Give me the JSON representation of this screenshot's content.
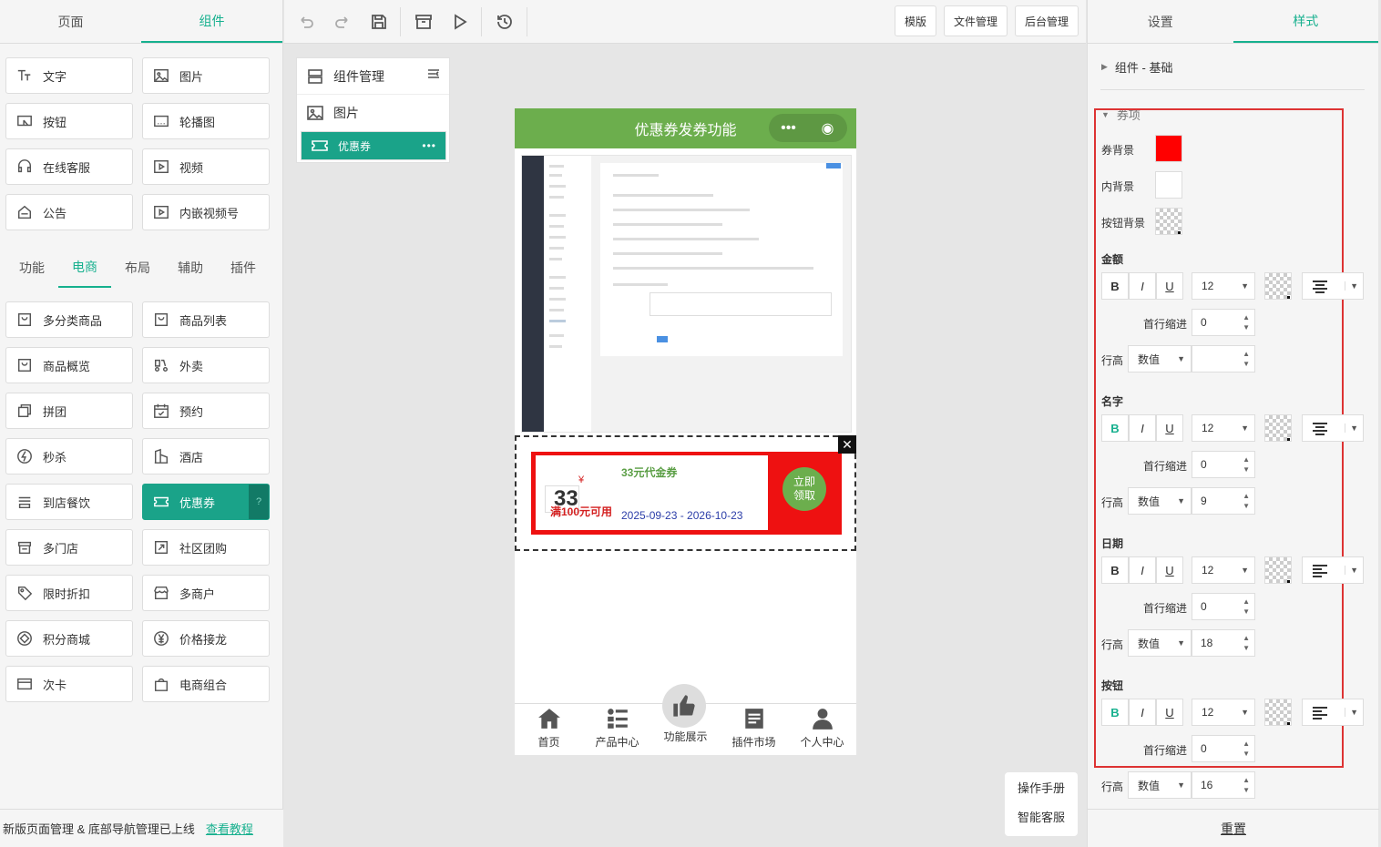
{
  "left_tabs": [
    "页面",
    "组件"
  ],
  "basic_components": [
    "文字",
    "图片",
    "按钮",
    "轮播图",
    "在线客服",
    "视频",
    "公告",
    "内嵌视频号"
  ],
  "category_tabs": [
    "功能",
    "电商",
    "布局",
    "辅助",
    "插件"
  ],
  "ecommerce_components": [
    "多分类商品",
    "商品列表",
    "商品概览",
    "外卖",
    "拼团",
    "预约",
    "秒杀",
    "酒店",
    "到店餐饮",
    "优惠券",
    "多门店",
    "社区团购",
    "限时折扣",
    "多商户",
    "积分商城",
    "价格接龙",
    "次卡",
    "电商组合"
  ],
  "help_glyph": "?",
  "notice": {
    "text": "新版页面管理 & 底部导航管理已上线",
    "link": "查看教程"
  },
  "toolbar": {
    "template": "模版",
    "files": "文件管理",
    "admin": "后台管理"
  },
  "manager": {
    "title": "组件管理",
    "items": [
      "图片",
      "优惠券"
    ],
    "more": "•••"
  },
  "phone": {
    "title": "优惠券发券功能",
    "capsule_more": "•••",
    "capsule_close": "◉",
    "coupon": {
      "currency": "¥",
      "amount": "33",
      "condition": "满100元可用",
      "name": "33元代金券",
      "date": "2025-09-23 - 2026-10-23",
      "button": "立即领取",
      "colors": {
        "bg": "#ee1111",
        "inner": "#ffffff",
        "button": "#6cae4d"
      }
    },
    "close_glyph": "✕",
    "tabbar": [
      "首页",
      "产品中心",
      "功能展示",
      "插件市场",
      "个人中心"
    ]
  },
  "float_menu": [
    "操作手册",
    "智能客服"
  ],
  "right_tabs": [
    "设置",
    "样式"
  ],
  "style_panel": {
    "basic_section": "组件 - 基础",
    "coupon_section": "券项",
    "coupon_bg_label": "券背景",
    "inner_bg_label": "内背景",
    "button_bg_label": "按钮背景",
    "indent_label": "首行缩进",
    "line_height_label": "行高",
    "line_height_mode": "数值",
    "fmt_b": "B",
    "fmt_i": "I",
    "fmt_u": "U",
    "groups": [
      {
        "name": "金额",
        "font_size": "12",
        "indent": "0",
        "line_height": "",
        "bold_on": false
      },
      {
        "name": "名字",
        "font_size": "12",
        "indent": "0",
        "line_height": "9",
        "bold_on": true
      },
      {
        "name": "日期",
        "font_size": "12",
        "indent": "0",
        "line_height": "18",
        "bold_on": false
      },
      {
        "name": "按钮",
        "font_size": "12",
        "indent": "0",
        "line_height": "16",
        "bold_on": true
      }
    ],
    "reset": "重置"
  }
}
